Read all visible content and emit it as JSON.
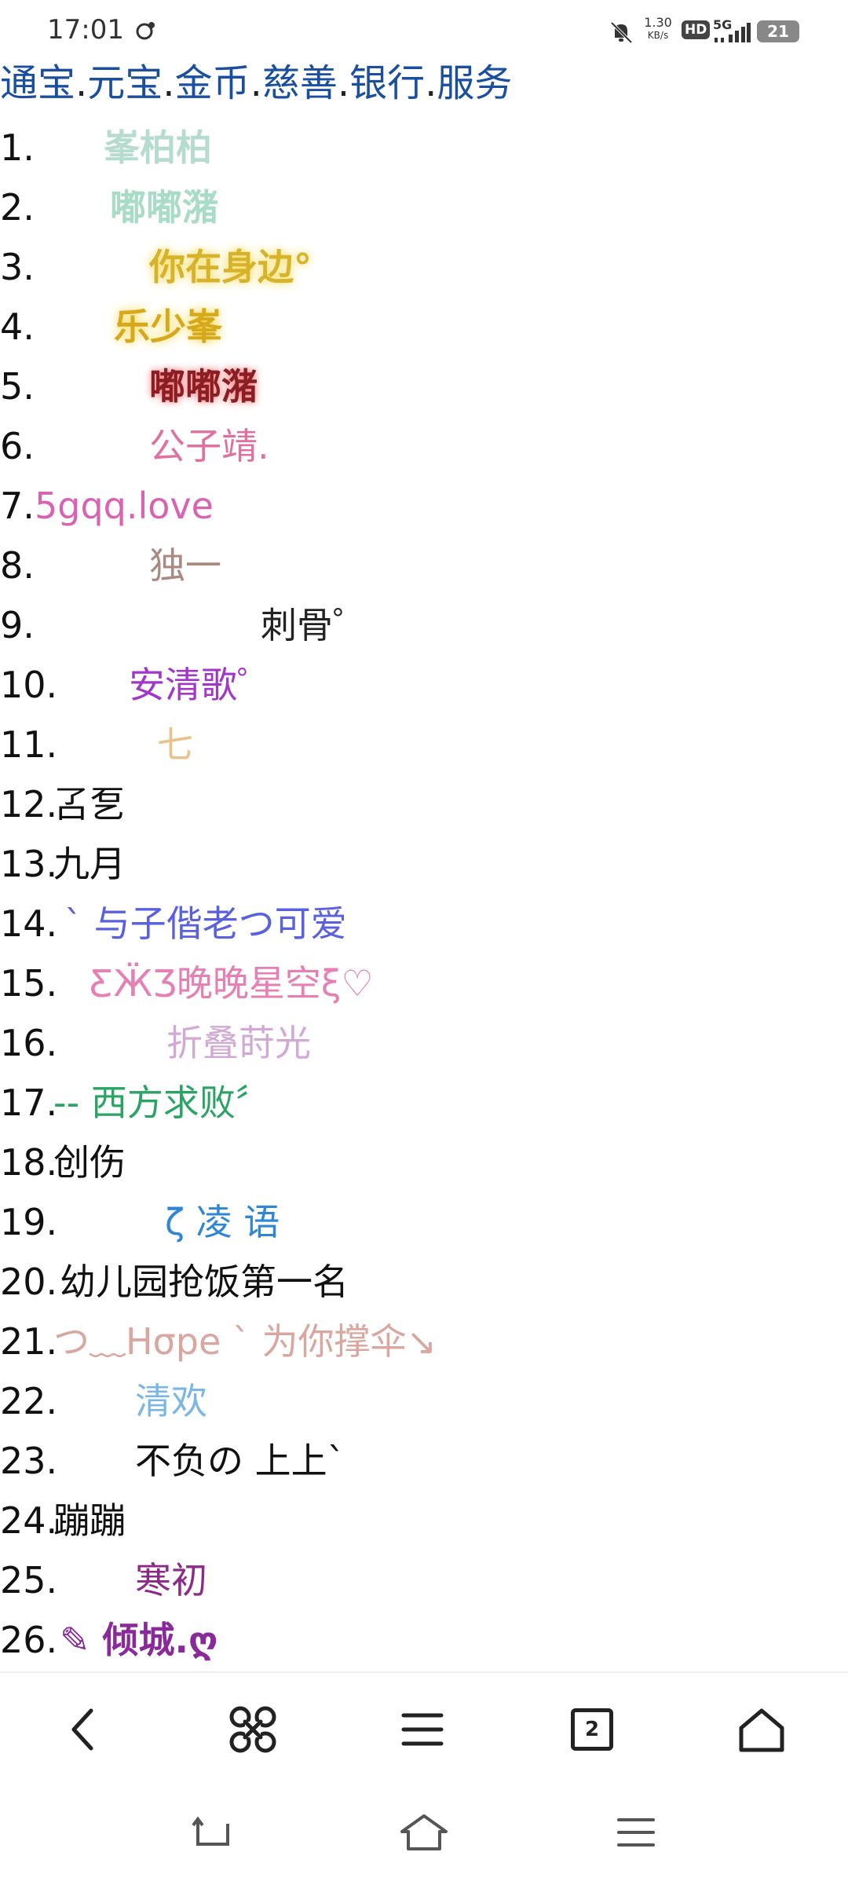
{
  "status_bar": {
    "time": "17:01",
    "speed": "1.30",
    "speed_unit": "KB/s",
    "hd": "HD",
    "net": "5G",
    "battery": "21"
  },
  "breadcrumbs": [
    {
      "label": "通宝"
    },
    {
      "label": "元宝"
    },
    {
      "label": "金币"
    },
    {
      "label": "慈善"
    },
    {
      "label": "银行"
    },
    {
      "label": "服务"
    }
  ],
  "breadcrumb_separator": ".",
  "rows": [
    {
      "num": "1.",
      "name": "峯柏柏",
      "color": "#b6dccf"
    },
    {
      "num": "2.",
      "name": "嘟嘟潴",
      "color": "#a9dcc7"
    },
    {
      "num": "3.",
      "name": "你在身边°",
      "color": "#d7b22b"
    },
    {
      "num": "4.",
      "name": "乐少峯",
      "color": "#d7a81c"
    },
    {
      "num": "5.",
      "name": "嘟嘟潴",
      "color": "#8b1e24"
    },
    {
      "num": "6.",
      "name": "公子靖.",
      "color": "#e070a0"
    },
    {
      "num": "7.",
      "name": "5gqq.love",
      "color": "#d963b2"
    },
    {
      "num": "8.",
      "name": "独一",
      "color": "#a88a80"
    },
    {
      "num": "9.",
      "name": "刺骨゜",
      "color": "#222222"
    },
    {
      "num": "10.",
      "name": "安清歌゜",
      "color": "#a236c9"
    },
    {
      "num": "11.",
      "name": "七",
      "color": "#e8c48c"
    },
    {
      "num": "12.",
      "name": "叾乭",
      "color": "#111111"
    },
    {
      "num": "13.",
      "name": "九月",
      "color": "#111111"
    },
    {
      "num": "14.",
      "name": "ˋ 与子偕老つ可爱",
      "color": "#5a61e0"
    },
    {
      "num": "15.",
      "name": "ƸӜƷ晚晚星空ξ♡",
      "color": "#e67fb3"
    },
    {
      "num": "16.",
      "name": "折叠莳光",
      "color": "#d1a9d4"
    },
    {
      "num": "17.",
      "name": "--   西方求败〞",
      "color": "#2aa464"
    },
    {
      "num": "18.",
      "name": "创伤",
      "color": "#111111"
    },
    {
      "num": "19.",
      "name": "ζ       凌 语",
      "color": "#2f86d6"
    },
    {
      "num": "20.",
      "name": "幼儿园抢饭第一名",
      "color": "#111111"
    },
    {
      "num": "21.",
      "name": "つ﹏Hσpe ˋ 为你撑伞↘",
      "color": "#d9a6a0"
    },
    {
      "num": "22.",
      "name": "清欢",
      "color": "#7ab6e6"
    },
    {
      "num": "23.",
      "name": "不负の   上上ˋ",
      "color": "#111111"
    },
    {
      "num": "24.",
      "name": "蹦蹦",
      "color": "#111111"
    },
    {
      "num": "25.",
      "name": "寒初",
      "color": "#8d2a88"
    },
    {
      "num": "26.",
      "name": "✎   倾城.ღ",
      "color": "#8a2a9a"
    }
  ],
  "bottom_nav": {
    "back_icon": "chevron-left-icon",
    "apps_icon": "command-icon",
    "menu_icon": "menu-icon",
    "tabs_count": "2",
    "home_icon": "home-icon"
  },
  "system_nav": {
    "back": "back-arrow-icon",
    "home": "home-outline-icon",
    "recents": "recents-menu-icon"
  }
}
